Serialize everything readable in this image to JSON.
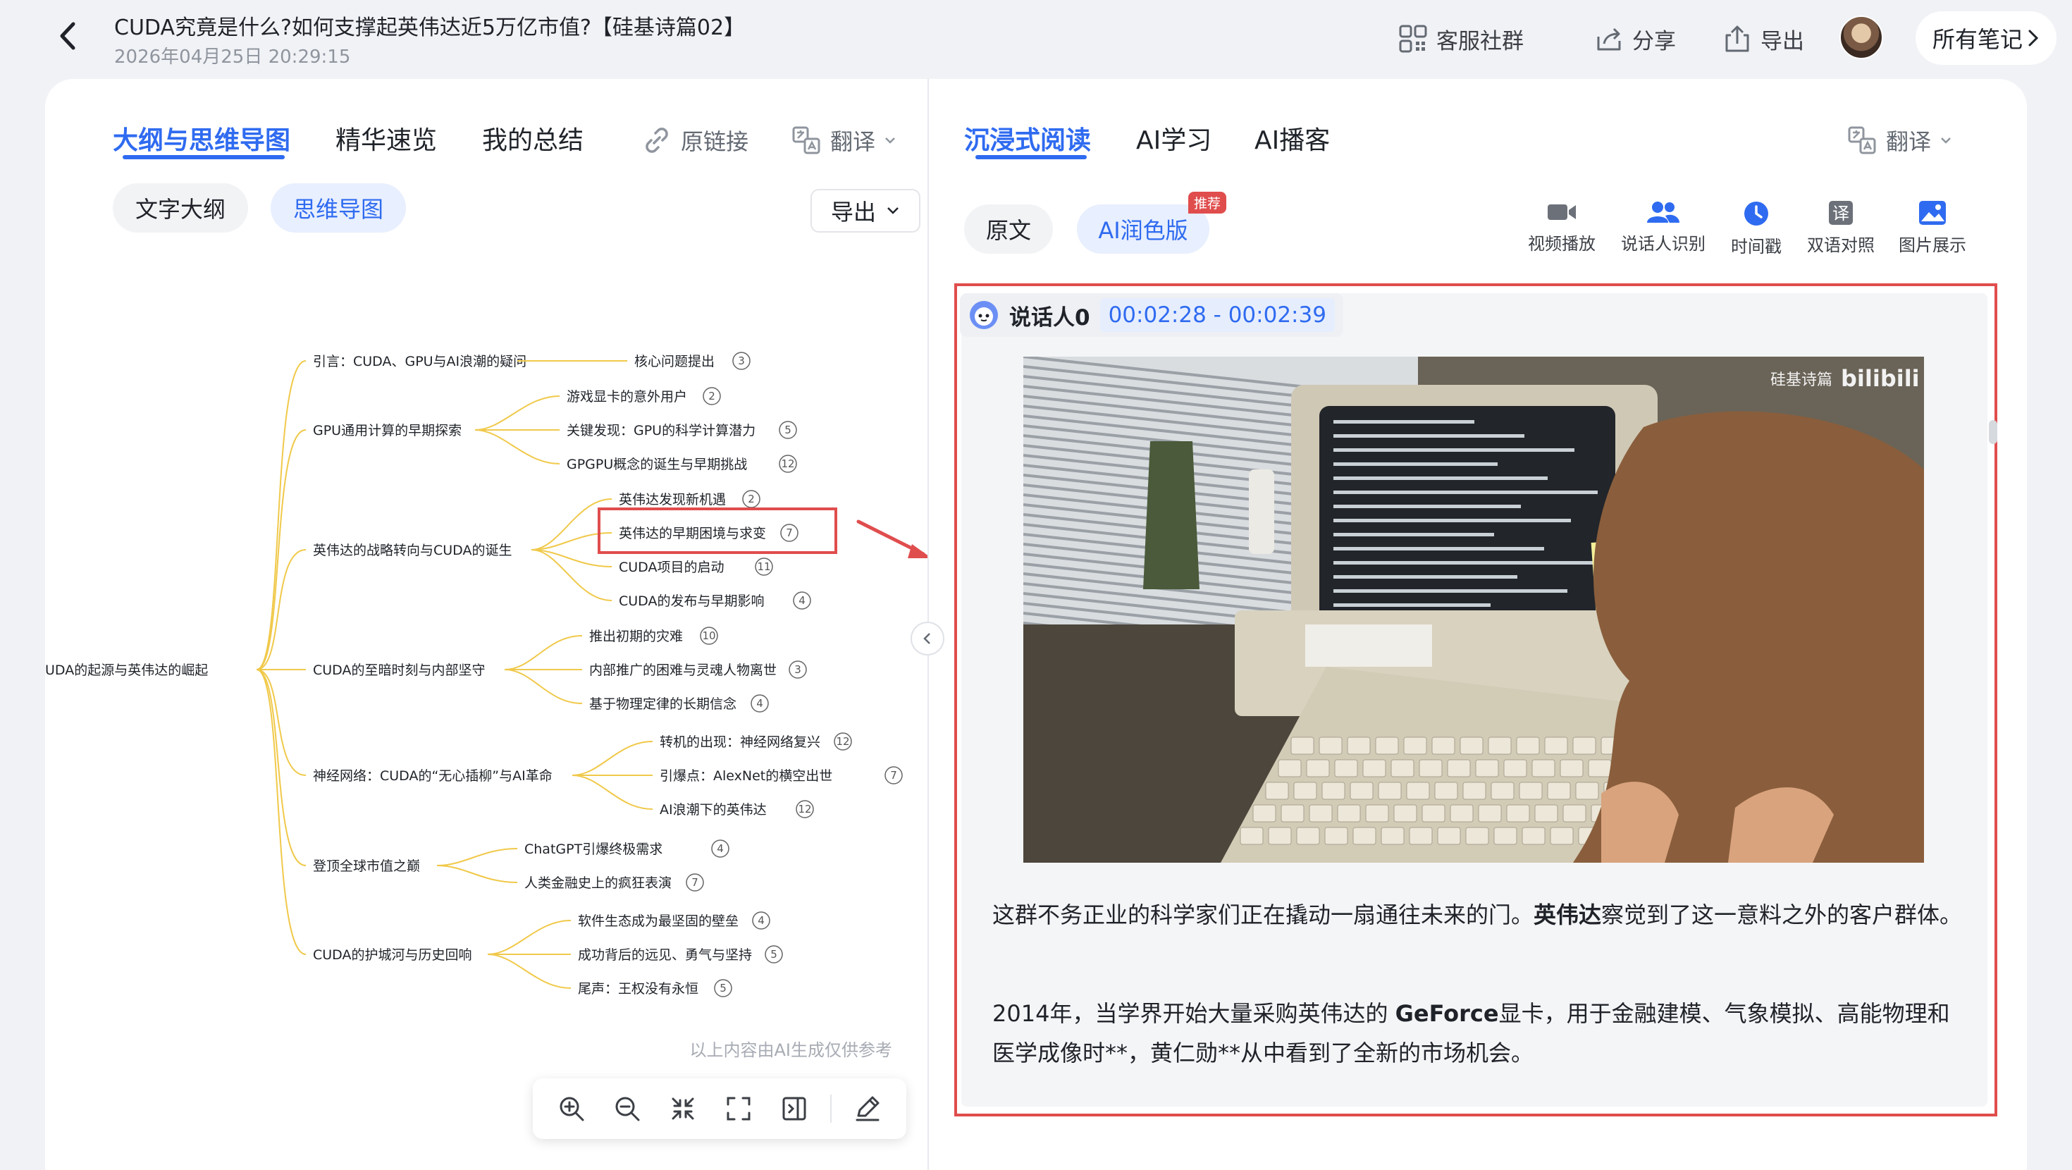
{
  "header": {
    "title": "CUDA究竟是什么?如何支撑起英伟达近5万亿市值?【硅基诗篇02】",
    "datetime": "2026年04月25日 20:29:15",
    "community_label": "客服社群",
    "share_label": "分享",
    "export_label": "导出",
    "all_notes_label": "所有笔记"
  },
  "left": {
    "tabs": [
      "大纲与思维导图",
      "精华速览",
      "我的总结"
    ],
    "source_link_label": "原链接",
    "translate_label": "翻译",
    "view_toggle": [
      "文字大纲",
      "思维导图"
    ],
    "export_dropdown_label": "导出",
    "disclaimer": "以上内容由AI生成仅供参考",
    "mindmap": {
      "root": "CUDA的起源与英伟达的崛起",
      "branches": [
        {
          "label": "引言：CUDA、GPU与AI浪潮的疑问",
          "children": [
            {
              "label": "核心问题提出",
              "count": "3"
            }
          ]
        },
        {
          "label": "GPU通用计算的早期探索",
          "children": [
            {
              "label": "游戏显卡的意外用户",
              "count": "2"
            },
            {
              "label": "关键发现：GPU的科学计算潜力",
              "count": "5"
            },
            {
              "label": "GPGPU概念的诞生与早期挑战",
              "count": "12"
            }
          ]
        },
        {
          "label": "英伟达的战略转向与CUDA的诞生",
          "children": [
            {
              "label": "英伟达发现新机遇",
              "count": "2"
            },
            {
              "label": "英伟达的早期困境与求变",
              "count": "7"
            },
            {
              "label": "CUDA项目的启动",
              "count": "11"
            },
            {
              "label": "CUDA的发布与早期影响",
              "count": "4"
            }
          ]
        },
        {
          "label": "CUDA的至暗时刻与内部坚守",
          "children": [
            {
              "label": "推出初期的灾难",
              "count": "10"
            },
            {
              "label": "内部推广的困难与灵魂人物离世",
              "count": "3"
            },
            {
              "label": "基于物理定律的长期信念",
              "count": "4"
            }
          ]
        },
        {
          "label": "神经网络：CUDA的“无心插柳”与AI革命",
          "children": [
            {
              "label": "转机的出现：神经网络复兴",
              "count": "12"
            },
            {
              "label": "引爆点：AlexNet的横空出世",
              "count": "7"
            },
            {
              "label": "AI浪潮下的英伟达",
              "count": "12"
            }
          ]
        },
        {
          "label": "登顶全球市值之巅",
          "children": [
            {
              "label": "ChatGPT引爆终极需求",
              "count": "4"
            },
            {
              "label": "人类金融史上的疯狂表演",
              "count": "7"
            }
          ]
        },
        {
          "label": "CUDA的护城河与历史回响",
          "children": [
            {
              "label": "软件生态成为最坚固的壁垒",
              "count": "4"
            },
            {
              "label": "成功背后的远见、勇气与坚持",
              "count": "5"
            },
            {
              "label": "尾声：王权没有永恒",
              "count": "5"
            }
          ]
        }
      ]
    }
  },
  "right": {
    "tabs": [
      "沉浸式阅读",
      "AI学习",
      "AI播客"
    ],
    "translate_label": "翻译",
    "modes": [
      "原文",
      "AI润色版"
    ],
    "recommend_badge": "推荐",
    "tools": [
      "视频播放",
      "说话人识别",
      "时间戳",
      "双语对照",
      "图片展示"
    ],
    "speaker": "说话人0",
    "time_range": "00:02:28 - 00:02:39",
    "video_watermark_channel": "硅基诗篇",
    "video_watermark_brand": "bilibili",
    "paragraphs": [
      {
        "before": "这群不务正业的科学家们正在撬动一扇通往未来的门。",
        "bold": "英伟达",
        "after": "察觉到了这一意料之外的客户群体。"
      },
      {
        "before": "2014年，当学界开始大量采购英伟达的 ",
        "bold": "GeForce",
        "after": "显卡，用于金融建模、气象模拟、高能物理和医学成像时**，黄仁勋**从中看到了全新的市场机会。"
      }
    ]
  },
  "colors": {
    "accent": "#2f6bf0",
    "highlight_red": "#e04d4d",
    "mindmap_line": "#f0c94a"
  }
}
